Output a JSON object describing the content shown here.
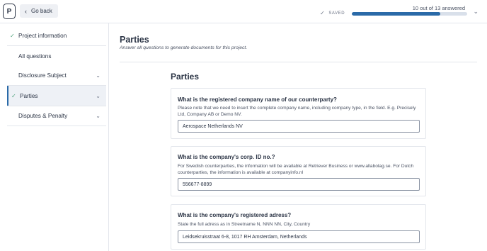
{
  "topbar": {
    "logo_text": "P",
    "go_back_label": "Go back",
    "saved_label": "SAVED",
    "progress_text": "10 out of 13 answered",
    "progress_fraction": 0.7692
  },
  "sidebar": {
    "items": [
      {
        "label": "Project information",
        "completed": true,
        "expandable": false,
        "active": false
      },
      {
        "label": "All questions",
        "completed": false,
        "expandable": false,
        "active": false
      },
      {
        "label": "Disclosure Subject",
        "completed": false,
        "expandable": true,
        "active": false
      },
      {
        "label": "Parties",
        "completed": true,
        "expandable": true,
        "active": true
      },
      {
        "label": "Disputes & Penalty",
        "completed": false,
        "expandable": true,
        "active": false
      }
    ]
  },
  "main": {
    "title": "Parties",
    "subtitle": "Answer all questions to generate documents for this project.",
    "section_title": "Parties",
    "questions": [
      {
        "question": "What is the registered company name of our counterparty?",
        "help": "Please note that we need to insert the complete company name, including company type, in the field. E.g. Precisely Ltd, Company AB or Demo NV.",
        "value": "Aerospace Netherlands NV"
      },
      {
        "question": "What is the company's corp. ID no.?",
        "help": "For Swedish counterparties, the information will be available at Retriever Business or www.allabolag.se. For Dutch counterparties, the information is available at companyinfo.nl",
        "value": "556677-8899"
      },
      {
        "question": "What is the company's registered adress?",
        "help": "State the full adress as in Streetname N, NNN NN, City, Country",
        "value": "Leidsekruisstraat 6-8, 1017 RH Amsterdam, Netherlands"
      }
    ]
  },
  "colors": {
    "accent": "#2a6aa8",
    "check_green": "#4fa37c",
    "progress_track": "#d9e0ea"
  },
  "icons": {
    "logo": "p-logo-icon",
    "back": "chevron-left-icon",
    "saved": "check-icon",
    "expand": "chevron-down-icon"
  }
}
